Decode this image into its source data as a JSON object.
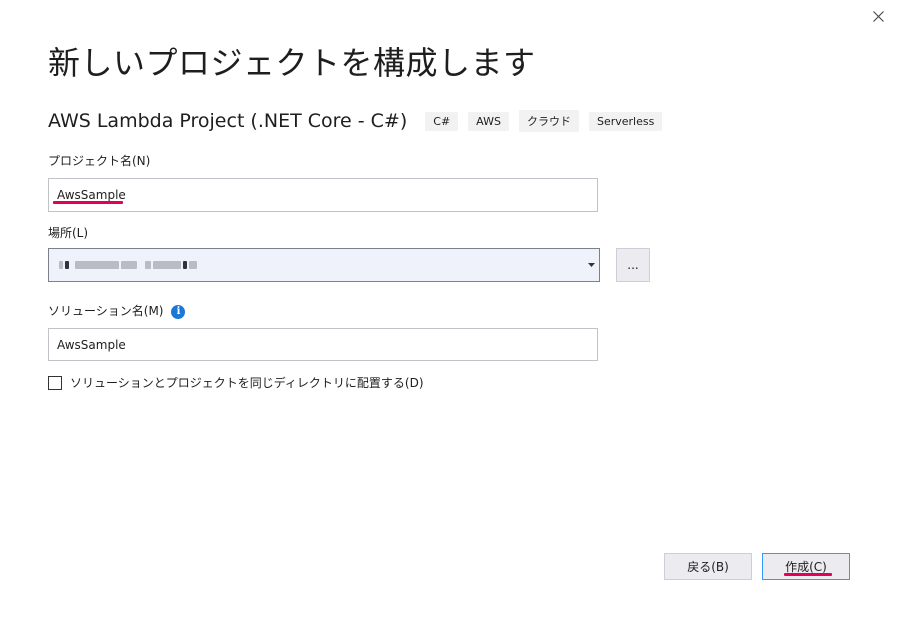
{
  "window": {
    "title": "新しいプロジェクトを構成します",
    "close_icon": "close-icon"
  },
  "template": {
    "name": "AWS Lambda Project (.NET Core - C#)",
    "tags": [
      "C#",
      "AWS",
      "クラウド",
      "Serverless"
    ]
  },
  "project_name": {
    "label": "プロジェクト名(N)",
    "value": "AwsSample"
  },
  "location": {
    "label": "場所(L)",
    "value_obscured": true,
    "browse_label": "..."
  },
  "solution_name": {
    "label": "ソリューション名(M)",
    "info_icon": "info-icon",
    "info_glyph": "i",
    "value": "AwsSample"
  },
  "same_directory": {
    "label": "ソリューションとプロジェクトを同じディレクトリに配置する(D)",
    "checked": false
  },
  "footer": {
    "back_label": "戻る(B)",
    "create_label": "作成(C)"
  },
  "colors": {
    "highlight_underline": "#e3005a",
    "info_blue": "#1b78d4",
    "primary_button_border": "#3399ff"
  }
}
